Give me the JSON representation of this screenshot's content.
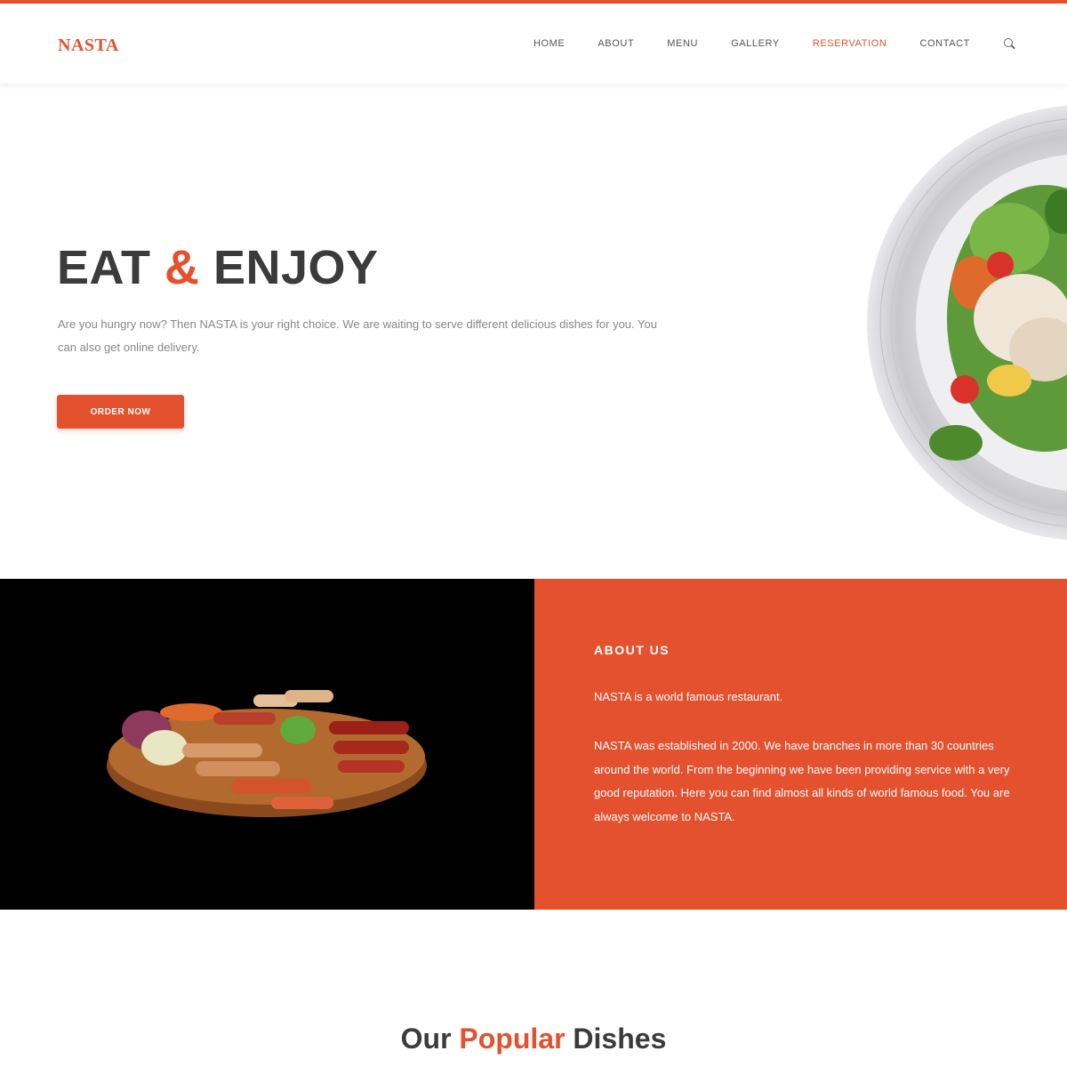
{
  "brand": {
    "logo": "NASTA",
    "accent": "#e4512e"
  },
  "nav": {
    "items": [
      {
        "label": "HOME",
        "active": false
      },
      {
        "label": "ABOUT",
        "active": false
      },
      {
        "label": "MENU",
        "active": false
      },
      {
        "label": "GALLERY",
        "active": false
      },
      {
        "label": "RESERVATION",
        "active": true
      },
      {
        "label": "CONTACT",
        "active": false
      }
    ],
    "search_icon": "search-icon"
  },
  "hero": {
    "title_part1": "EAT ",
    "title_amp": "&",
    "title_part2": " ENJOY",
    "text": "Are you hungry now? Then NASTA is your right choice. We are waiting to serve different delicious dishes for you. You can also get online delivery.",
    "button": "ORDER NOW"
  },
  "about": {
    "title": "ABOUT US",
    "subtitle": "NASTA is a world famous restaurant.",
    "text": "NASTA was established in 2000. We have branches in more than 30 countries around the world. From the beginning we have been providing service with a very good reputation. Here you can find almost all kinds of world famous food. You are always welcome to NASTA."
  },
  "popular": {
    "part1": "Our ",
    "highlight": "Popular",
    "part2": " Dishes"
  }
}
